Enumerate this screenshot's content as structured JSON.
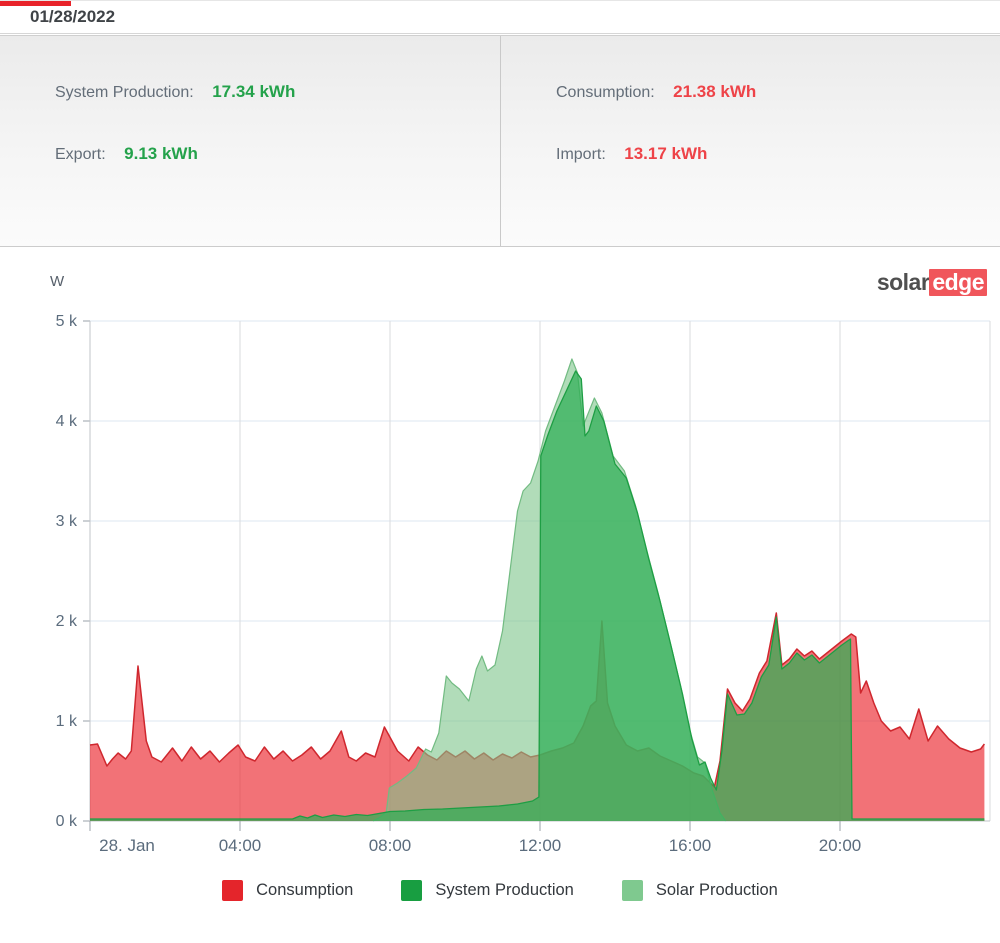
{
  "title_bar": {
    "date": "01/28/2022"
  },
  "summary": {
    "left": [
      {
        "label": "System Production:",
        "value": "17.34 kWh",
        "tone": "green"
      },
      {
        "label": "Export:",
        "value": "9.13 kWh",
        "tone": "green"
      }
    ],
    "right": [
      {
        "label": "Consumption:",
        "value": "21.38 kWh",
        "tone": "red"
      },
      {
        "label": "Import:",
        "value": "13.17 kWh",
        "tone": "red"
      }
    ]
  },
  "logo": {
    "part1": "solar",
    "part2": "edge"
  },
  "colors": {
    "production_green": "#24a24b",
    "consumption_red": "#ee4348",
    "system_green": "#189e41",
    "solar_light_green": "#7fc98f",
    "logo_red": "#f0565b",
    "tab_red": "#e8232a"
  },
  "chart_data": {
    "type": "area",
    "unit_label": "W",
    "x_axis": {
      "range_hours": [
        0,
        24
      ],
      "tick_hours": [
        0,
        4,
        8,
        12,
        16,
        20
      ],
      "tick_labels": [
        "28. Jan",
        "04:00",
        "08:00",
        "12:00",
        "16:00",
        "20:00"
      ],
      "gridline_hours": [
        4,
        8,
        12,
        16,
        20,
        24
      ]
    },
    "y_axis": {
      "range_watts": [
        0,
        5000
      ],
      "ticks": [
        0,
        1000,
        2000,
        3000,
        4000,
        5000
      ],
      "tick_labels": [
        "0 k",
        "1 k",
        "2 k",
        "3 k",
        "4 k",
        "5 k"
      ],
      "grid": true
    },
    "legend_position": "bottom-center",
    "legend": [
      {
        "label": "Consumption",
        "color": "#e4252b"
      },
      {
        "label": "System Production",
        "color": "#189e41"
      },
      {
        "label": "Solar Production",
        "color": "#7fc98f"
      }
    ],
    "series": [
      {
        "name": "Consumption",
        "fill": "rgba(236,41,48,0.66)",
        "stroke": "#cf272e",
        "stroke_width": 1.5,
        "points": [
          [
            0,
            760
          ],
          [
            0.2,
            770
          ],
          [
            0.45,
            550
          ],
          [
            0.6,
            620
          ],
          [
            0.75,
            680
          ],
          [
            0.95,
            620
          ],
          [
            1.1,
            700
          ],
          [
            1.28,
            1550
          ],
          [
            1.5,
            800
          ],
          [
            1.65,
            640
          ],
          [
            1.9,
            590
          ],
          [
            2.2,
            730
          ],
          [
            2.45,
            600
          ],
          [
            2.7,
            740
          ],
          [
            2.95,
            620
          ],
          [
            3.2,
            700
          ],
          [
            3.45,
            590
          ],
          [
            3.7,
            680
          ],
          [
            3.95,
            760
          ],
          [
            4.15,
            640
          ],
          [
            4.4,
            600
          ],
          [
            4.65,
            740
          ],
          [
            4.9,
            620
          ],
          [
            5.15,
            700
          ],
          [
            5.4,
            600
          ],
          [
            5.65,
            660
          ],
          [
            5.9,
            740
          ],
          [
            6.15,
            620
          ],
          [
            6.4,
            700
          ],
          [
            6.7,
            900
          ],
          [
            6.9,
            640
          ],
          [
            7.1,
            600
          ],
          [
            7.35,
            680
          ],
          [
            7.6,
            640
          ],
          [
            7.85,
            940
          ],
          [
            8.2,
            700
          ],
          [
            8.5,
            600
          ],
          [
            8.75,
            740
          ],
          [
            9.0,
            660
          ],
          [
            9.25,
            610
          ],
          [
            9.5,
            700
          ],
          [
            9.75,
            640
          ],
          [
            10.0,
            700
          ],
          [
            10.25,
            620
          ],
          [
            10.5,
            680
          ],
          [
            10.75,
            610
          ],
          [
            11.0,
            670
          ],
          [
            11.25,
            630
          ],
          [
            11.5,
            690
          ],
          [
            11.75,
            640
          ],
          [
            12.0,
            660
          ],
          [
            12.3,
            700
          ],
          [
            12.6,
            730
          ],
          [
            12.9,
            780
          ],
          [
            13.15,
            950
          ],
          [
            13.35,
            1150
          ],
          [
            13.5,
            1200
          ],
          [
            13.65,
            2000
          ],
          [
            13.8,
            1180
          ],
          [
            14.0,
            950
          ],
          [
            14.3,
            760
          ],
          [
            14.6,
            700
          ],
          [
            14.9,
            730
          ],
          [
            15.2,
            650
          ],
          [
            15.5,
            600
          ],
          [
            15.8,
            550
          ],
          [
            16.1,
            480
          ],
          [
            16.35,
            450
          ],
          [
            16.65,
            340
          ],
          [
            16.8,
            600
          ],
          [
            17.0,
            1320
          ],
          [
            17.2,
            1180
          ],
          [
            17.4,
            1100
          ],
          [
            17.6,
            1220
          ],
          [
            17.85,
            1480
          ],
          [
            18.05,
            1600
          ],
          [
            18.3,
            2080
          ],
          [
            18.45,
            1560
          ],
          [
            18.65,
            1620
          ],
          [
            18.85,
            1720
          ],
          [
            19.05,
            1650
          ],
          [
            19.25,
            1700
          ],
          [
            19.45,
            1620
          ],
          [
            19.65,
            1680
          ],
          [
            19.85,
            1740
          ],
          [
            20.05,
            1800
          ],
          [
            20.3,
            1870
          ],
          [
            20.42,
            1840
          ],
          [
            20.55,
            1280
          ],
          [
            20.7,
            1400
          ],
          [
            20.9,
            1180
          ],
          [
            21.1,
            1000
          ],
          [
            21.35,
            900
          ],
          [
            21.6,
            940
          ],
          [
            21.85,
            820
          ],
          [
            22.1,
            1120
          ],
          [
            22.35,
            800
          ],
          [
            22.6,
            950
          ],
          [
            22.9,
            820
          ],
          [
            23.2,
            730
          ],
          [
            23.5,
            690
          ],
          [
            23.75,
            720
          ],
          [
            23.85,
            770
          ]
        ]
      },
      {
        "name": "Solar Production",
        "fill": "rgba(125,196,138,0.6)",
        "stroke": "#72bb82",
        "stroke_width": 1.2,
        "points": [
          [
            7.55,
            0
          ],
          [
            7.75,
            40
          ],
          [
            7.9,
            90
          ],
          [
            7.98,
            330
          ],
          [
            8.2,
            380
          ],
          [
            8.45,
            450
          ],
          [
            8.7,
            530
          ],
          [
            8.95,
            720
          ],
          [
            9.1,
            690
          ],
          [
            9.3,
            880
          ],
          [
            9.5,
            1450
          ],
          [
            9.65,
            1380
          ],
          [
            9.85,
            1320
          ],
          [
            10.1,
            1200
          ],
          [
            10.3,
            1520
          ],
          [
            10.45,
            1650
          ],
          [
            10.6,
            1500
          ],
          [
            10.8,
            1560
          ],
          [
            11.0,
            1900
          ],
          [
            11.2,
            2500
          ],
          [
            11.4,
            3100
          ],
          [
            11.55,
            3300
          ],
          [
            11.75,
            3380
          ],
          [
            11.95,
            3600
          ],
          [
            12.15,
            3900
          ],
          [
            12.4,
            4150
          ],
          [
            12.65,
            4400
          ],
          [
            12.85,
            4620
          ],
          [
            13.0,
            4480
          ],
          [
            13.15,
            3950
          ],
          [
            13.45,
            4230
          ],
          [
            13.65,
            4080
          ],
          [
            13.95,
            3650
          ],
          [
            14.25,
            3500
          ],
          [
            14.55,
            3150
          ],
          [
            14.85,
            2700
          ],
          [
            15.15,
            2280
          ],
          [
            15.45,
            1820
          ],
          [
            15.75,
            1350
          ],
          [
            16.0,
            900
          ],
          [
            16.2,
            640
          ],
          [
            16.4,
            580
          ],
          [
            16.6,
            300
          ],
          [
            16.8,
            80
          ],
          [
            16.95,
            0
          ]
        ]
      },
      {
        "name": "System Production",
        "fill": "rgba(46,174,84,0.72)",
        "stroke": "#1e9e44",
        "stroke_width": 1.3,
        "points": [
          [
            0,
            20
          ],
          [
            5.4,
            20
          ],
          [
            5.6,
            50
          ],
          [
            5.8,
            30
          ],
          [
            6.0,
            60
          ],
          [
            6.2,
            35
          ],
          [
            6.5,
            60
          ],
          [
            6.8,
            45
          ],
          [
            7.1,
            65
          ],
          [
            7.4,
            55
          ],
          [
            7.7,
            75
          ],
          [
            8.0,
            95
          ],
          [
            8.4,
            100
          ],
          [
            8.9,
            115
          ],
          [
            9.4,
            120
          ],
          [
            9.9,
            130
          ],
          [
            10.4,
            140
          ],
          [
            10.9,
            150
          ],
          [
            11.4,
            170
          ],
          [
            11.8,
            200
          ],
          [
            11.97,
            240
          ],
          [
            12.02,
            3650
          ],
          [
            12.2,
            3850
          ],
          [
            12.45,
            4100
          ],
          [
            12.7,
            4300
          ],
          [
            12.95,
            4500
          ],
          [
            13.1,
            4420
          ],
          [
            13.2,
            3850
          ],
          [
            13.3,
            3900
          ],
          [
            13.5,
            4150
          ],
          [
            13.7,
            4000
          ],
          [
            14.0,
            3570
          ],
          [
            14.3,
            3430
          ],
          [
            14.6,
            3080
          ],
          [
            14.9,
            2620
          ],
          [
            15.2,
            2200
          ],
          [
            15.5,
            1740
          ],
          [
            15.8,
            1270
          ],
          [
            16.05,
            820
          ],
          [
            16.25,
            560
          ],
          [
            16.4,
            590
          ],
          [
            16.55,
            430
          ],
          [
            16.7,
            310
          ],
          [
            16.85,
            700
          ],
          [
            17.0,
            1270
          ],
          [
            17.25,
            1060
          ],
          [
            17.45,
            1070
          ],
          [
            17.65,
            1180
          ],
          [
            17.9,
            1440
          ],
          [
            18.1,
            1560
          ],
          [
            18.3,
            2040
          ],
          [
            18.45,
            1520
          ],
          [
            18.65,
            1580
          ],
          [
            18.85,
            1680
          ],
          [
            19.05,
            1610
          ],
          [
            19.25,
            1660
          ],
          [
            19.45,
            1580
          ],
          [
            19.65,
            1640
          ],
          [
            19.85,
            1700
          ],
          [
            20.05,
            1760
          ],
          [
            20.2,
            1800
          ],
          [
            20.28,
            1820
          ],
          [
            20.32,
            20
          ],
          [
            23.85,
            20
          ]
        ]
      }
    ]
  }
}
